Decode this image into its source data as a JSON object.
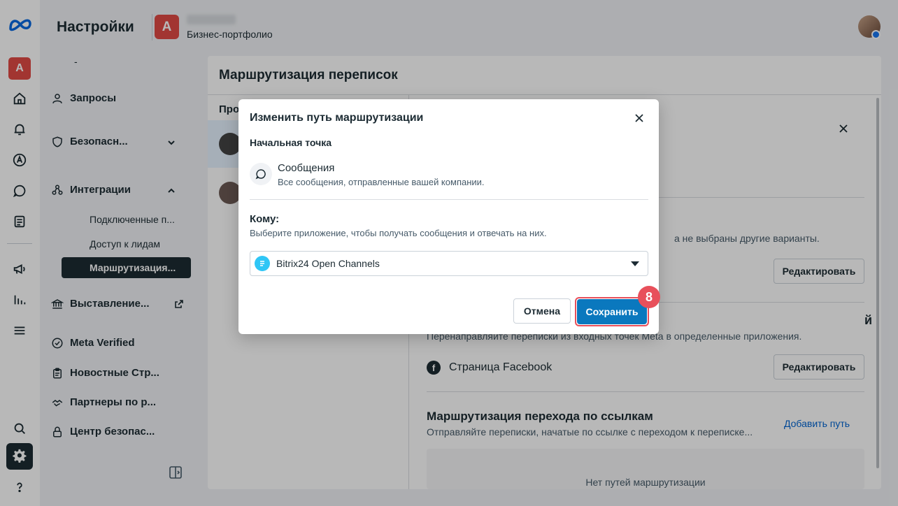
{
  "header": {
    "title": "Настройки",
    "business_initial": "A",
    "business_type": "Бизнес-портфолио"
  },
  "rail": {
    "business_initial": "A",
    "icons": [
      "meta-logo-icon",
      "home-icon",
      "bell-icon",
      "ads-icon",
      "chat-icon",
      "pages-icon",
      "megaphone-icon",
      "analytics-icon",
      "menu-icon",
      "search-icon",
      "gear-icon",
      "help-icon"
    ]
  },
  "sidebar": {
    "dash": "-",
    "items": [
      {
        "label": "Запросы",
        "icon": "user-icon"
      },
      {
        "label": "Безопасн...",
        "icon": "shield-icon"
      },
      {
        "label": "Интеграции",
        "icon": "integrations-icon"
      },
      {
        "label": "Выставление...",
        "icon": "bank-icon"
      },
      {
        "label": "Meta Verified",
        "icon": "verified-icon"
      },
      {
        "label": "Новостные Стр...",
        "icon": "clipboard-icon"
      },
      {
        "label": "Партнеры по р...",
        "icon": "partners-icon"
      },
      {
        "label": "Центр безопас...",
        "icon": "lock-icon"
      }
    ],
    "sub_items": [
      "Подключенные п...",
      "Доступ к лидам",
      "Маршрутизация..."
    ]
  },
  "panel": {
    "title": "Маршрутизация переписок",
    "list_header": "Про",
    "detail": {
      "default_note": "а не выбраны другие варианты.",
      "edit_label_1": "Редактировать",
      "section2_title_tail": "й",
      "section2_sub": "Перенаправляйте переписки из входных точек Meta в определенные приложения.",
      "fb_page": "Страница Facebook",
      "edit_label_2": "Редактировать",
      "section3_title": "Маршрутизация перехода по ссылкам",
      "section3_sub": "Отправляйте переписки, начатые по ссылке с переходом к переписке...",
      "add_route": "Добавить путь",
      "empty": "Нет путей маршрутизации"
    }
  },
  "modal": {
    "title": "Изменить путь маршрутизации",
    "start_label": "Начальная точка",
    "start_name": "Сообщения",
    "start_desc": "Все сообщения, отправленные вашей компании.",
    "to_label": "Кому:",
    "to_help": "Выберите приложение, чтобы получать сообщения и отвечать на них.",
    "selected_app": "Bitrix24 Open Channels",
    "cancel": "Отмена",
    "save": "Сохранить",
    "step": "8"
  },
  "colors": {
    "primary": "#0a78be",
    "highlight": "#e8505b",
    "dark": "#1c2b33"
  }
}
